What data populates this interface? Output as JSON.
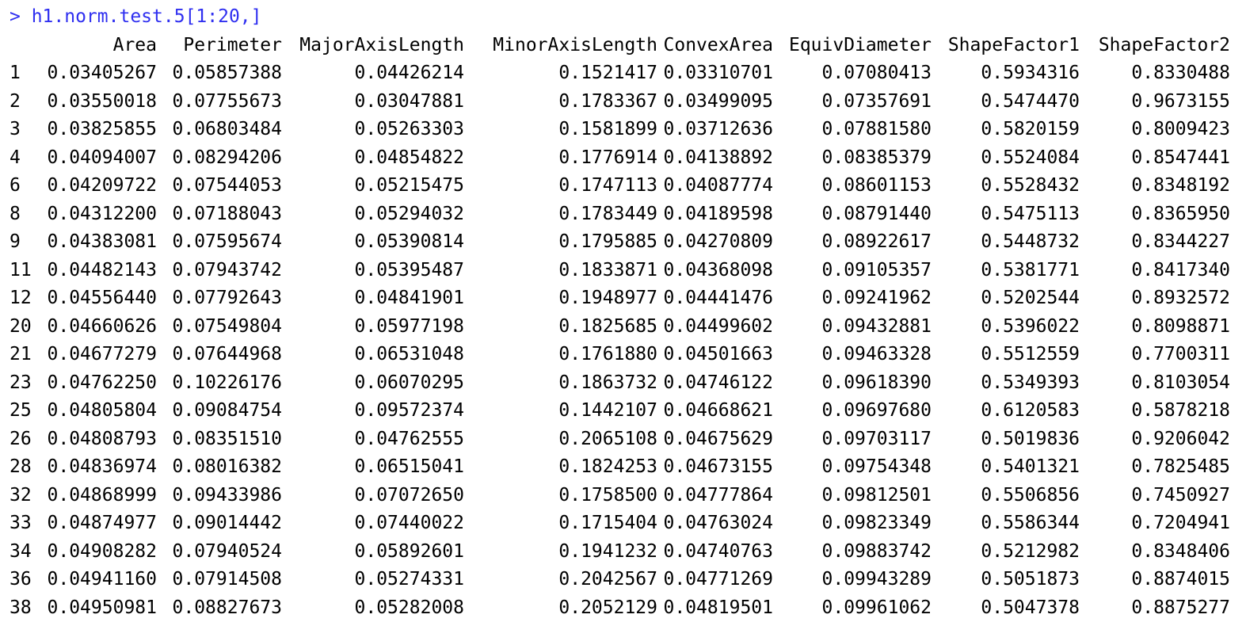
{
  "console": {
    "prompt": "> ",
    "command": "h1.norm.test.5[1:20,]",
    "columns": [
      "",
      "Area",
      "Perimeter",
      "MajorAxisLength",
      "MinorAxisLength",
      "ConvexArea",
      "EquivDiameter",
      "ShapeFactor1",
      "ShapeFactor2"
    ],
    "rows": [
      [
        "1",
        "0.03405267",
        "0.05857388",
        "0.04426214",
        "0.1521417",
        "0.03310701",
        "0.07080413",
        "0.5934316",
        "0.8330488"
      ],
      [
        "2",
        "0.03550018",
        "0.07755673",
        "0.03047881",
        "0.1783367",
        "0.03499095",
        "0.07357691",
        "0.5474470",
        "0.9673155"
      ],
      [
        "3",
        "0.03825855",
        "0.06803484",
        "0.05263303",
        "0.1581899",
        "0.03712636",
        "0.07881580",
        "0.5820159",
        "0.8009423"
      ],
      [
        "4",
        "0.04094007",
        "0.08294206",
        "0.04854822",
        "0.1776914",
        "0.04138892",
        "0.08385379",
        "0.5524084",
        "0.8547441"
      ],
      [
        "6",
        "0.04209722",
        "0.07544053",
        "0.05215475",
        "0.1747113",
        "0.04087774",
        "0.08601153",
        "0.5528432",
        "0.8348192"
      ],
      [
        "8",
        "0.04312200",
        "0.07188043",
        "0.05294032",
        "0.1783449",
        "0.04189598",
        "0.08791440",
        "0.5475113",
        "0.8365950"
      ],
      [
        "9",
        "0.04383081",
        "0.07595674",
        "0.05390814",
        "0.1795885",
        "0.04270809",
        "0.08922617",
        "0.5448732",
        "0.8344227"
      ],
      [
        "11",
        "0.04482143",
        "0.07943742",
        "0.05395487",
        "0.1833871",
        "0.04368098",
        "0.09105357",
        "0.5381771",
        "0.8417340"
      ],
      [
        "12",
        "0.04556440",
        "0.07792643",
        "0.04841901",
        "0.1948977",
        "0.04441476",
        "0.09241962",
        "0.5202544",
        "0.8932572"
      ],
      [
        "20",
        "0.04660626",
        "0.07549804",
        "0.05977198",
        "0.1825685",
        "0.04499602",
        "0.09432881",
        "0.5396022",
        "0.8098871"
      ],
      [
        "21",
        "0.04677279",
        "0.07644968",
        "0.06531048",
        "0.1761880",
        "0.04501663",
        "0.09463328",
        "0.5512559",
        "0.7700311"
      ],
      [
        "23",
        "0.04762250",
        "0.10226176",
        "0.06070295",
        "0.1863732",
        "0.04746122",
        "0.09618390",
        "0.5349393",
        "0.8103054"
      ],
      [
        "25",
        "0.04805804",
        "0.09084754",
        "0.09572374",
        "0.1442107",
        "0.04668621",
        "0.09697680",
        "0.6120583",
        "0.5878218"
      ],
      [
        "26",
        "0.04808793",
        "0.08351510",
        "0.04762555",
        "0.2065108",
        "0.04675629",
        "0.09703117",
        "0.5019836",
        "0.9206042"
      ],
      [
        "28",
        "0.04836974",
        "0.08016382",
        "0.06515041",
        "0.1824253",
        "0.04673155",
        "0.09754348",
        "0.5401321",
        "0.7825485"
      ],
      [
        "32",
        "0.04868999",
        "0.09433986",
        "0.07072650",
        "0.1758500",
        "0.04777864",
        "0.09812501",
        "0.5506856",
        "0.7450927"
      ],
      [
        "33",
        "0.04874977",
        "0.09014442",
        "0.07440022",
        "0.1715404",
        "0.04763024",
        "0.09823349",
        "0.5586344",
        "0.7204941"
      ],
      [
        "34",
        "0.04908282",
        "0.07940524",
        "0.05892601",
        "0.1941232",
        "0.04740763",
        "0.09883742",
        "0.5212982",
        "0.8348406"
      ],
      [
        "36",
        "0.04941160",
        "0.07914508",
        "0.05274331",
        "0.2042567",
        "0.04771269",
        "0.09943289",
        "0.5051873",
        "0.8874015"
      ],
      [
        "38",
        "0.04950981",
        "0.08827673",
        "0.05282008",
        "0.2052129",
        "0.04819501",
        "0.09961062",
        "0.5047378",
        "0.8875277"
      ]
    ]
  },
  "colors": {
    "command_text": "#2f2ff0",
    "output_text": "#000000",
    "background": "#ffffff"
  }
}
